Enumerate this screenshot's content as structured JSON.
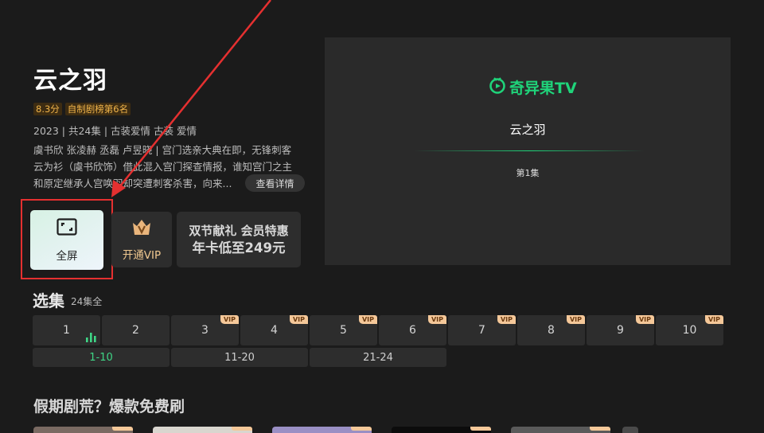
{
  "show": {
    "title": "云之羽",
    "rating": "8.3分",
    "rank": "自制剧榜第6名",
    "meta": "2023 | 共24集 | 古装爱情 古装 爱情",
    "description_lines": [
      "虞书欣 张凌赫 丞磊 卢昱晓 | 宫门选亲大典在即，无锋刺客",
      "云为衫（虞书欣饰）借此混入宫门探查情报，谁知宫门之主",
      "和原定继承人宫唤羽却突遭刺客杀害，向来..."
    ],
    "detail_label": "查看详情"
  },
  "actions": {
    "fullscreen_label": "全屏",
    "vip_label": "开通VIP",
    "promo_line1": "双节献礼 会员特惠",
    "promo_line2": "年卡低至249元"
  },
  "player": {
    "logo_text": "奇异果TV",
    "title": "云之羽",
    "episode": "第1集"
  },
  "selection": {
    "title": "选集",
    "count": "24集全",
    "vip_tag": "VIP",
    "episodes": [
      {
        "label": "1",
        "vip": false,
        "playing": true
      },
      {
        "label": "2",
        "vip": false,
        "playing": false
      },
      {
        "label": "3",
        "vip": true,
        "playing": false
      },
      {
        "label": "4",
        "vip": true,
        "playing": false
      },
      {
        "label": "5",
        "vip": true,
        "playing": false
      },
      {
        "label": "6",
        "vip": true,
        "playing": false
      },
      {
        "label": "7",
        "vip": true,
        "playing": false
      },
      {
        "label": "8",
        "vip": true,
        "playing": false
      },
      {
        "label": "9",
        "vip": true,
        "playing": false
      },
      {
        "label": "10",
        "vip": true,
        "playing": false
      }
    ],
    "ranges": [
      {
        "label": "1-10",
        "active": true
      },
      {
        "label": "11-20",
        "active": false
      },
      {
        "label": "21-24",
        "active": false
      }
    ]
  },
  "recommend": {
    "title": "假期剧荒？爆款免费刷"
  },
  "colors": {
    "accent": "#1fd47a",
    "highlight": "#e53030",
    "vip_gold": "#f5c899"
  }
}
